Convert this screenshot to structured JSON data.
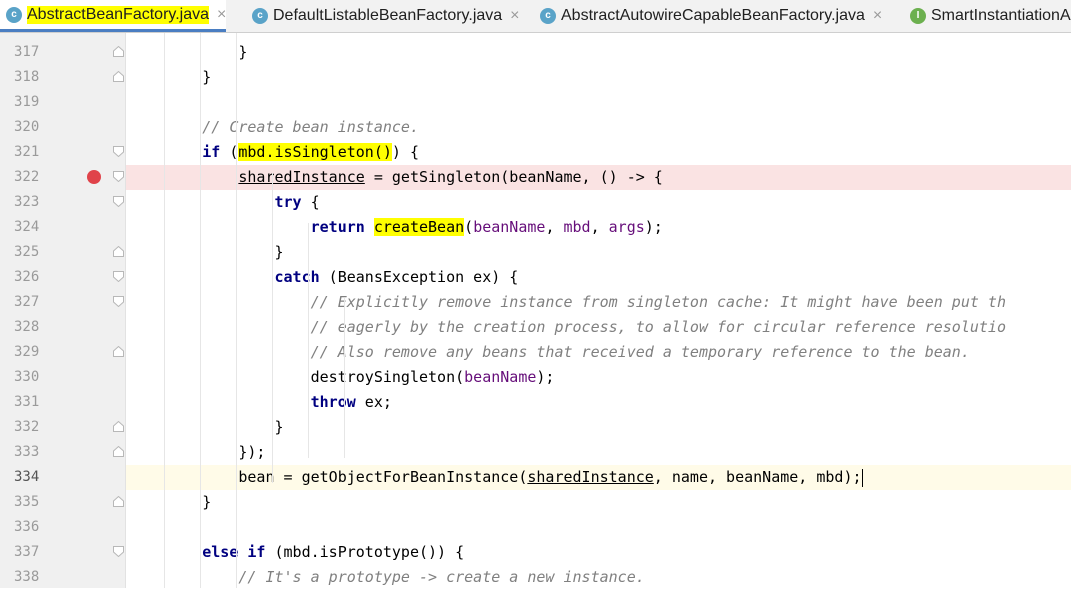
{
  "tabs": [
    {
      "label": "AbstractBeanFactory.java",
      "icon": "class-icon",
      "badge": "c",
      "active": true,
      "highlight": true
    },
    {
      "label": "DefaultListableBeanFactory.java",
      "icon": "class-icon",
      "badge": "c",
      "active": false
    },
    {
      "label": "AbstractAutowireCapableBeanFactory.java",
      "icon": "class-icon",
      "badge": "c",
      "active": false
    },
    {
      "label": "SmartInstantiationA",
      "icon": "interface-icon",
      "badge": "I",
      "active": false
    }
  ],
  "tab_close": "×",
  "colors": {
    "keyword": "#000080",
    "comment": "#808080",
    "field": "#660e7a",
    "breakpoint": "#e0434a",
    "search_highlight": "#ffff00",
    "active_tab_underline": "#4a7ec2"
  },
  "editor": {
    "breakpoint_line": "322",
    "caret_line": "334",
    "lines": [
      {
        "num": "317",
        "segments": [
          {
            "t": "            }"
          }
        ]
      },
      {
        "num": "318",
        "segments": [
          {
            "t": "        }"
          }
        ]
      },
      {
        "num": "319",
        "segments": [
          {
            "t": ""
          }
        ]
      },
      {
        "num": "320",
        "segments": [
          {
            "t": "        "
          },
          {
            "t": "// Create bean instance.",
            "c": "cm"
          }
        ]
      },
      {
        "num": "321",
        "segments": [
          {
            "t": "        "
          },
          {
            "t": "if",
            "c": "kw"
          },
          {
            "t": " ("
          },
          {
            "t": "mbd.isSingleton()",
            "c": "hl"
          },
          {
            "t": ") {"
          }
        ]
      },
      {
        "num": "322",
        "segments": [
          {
            "t": "            "
          },
          {
            "t": "sharedInstance",
            "c": "ul"
          },
          {
            "t": " = getSingleton(beanName, () -> {"
          }
        ]
      },
      {
        "num": "323",
        "segments": [
          {
            "t": "                "
          },
          {
            "t": "try",
            "c": "kw"
          },
          {
            "t": " {"
          }
        ]
      },
      {
        "num": "324",
        "segments": [
          {
            "t": "                    "
          },
          {
            "t": "return",
            "c": "kw"
          },
          {
            "t": " "
          },
          {
            "t": "createBean",
            "c": "hl"
          },
          {
            "t": "("
          },
          {
            "t": "beanName",
            "c": "fld"
          },
          {
            "t": ", "
          },
          {
            "t": "mbd",
            "c": "fld"
          },
          {
            "t": ", "
          },
          {
            "t": "args",
            "c": "fld"
          },
          {
            "t": ");"
          }
        ]
      },
      {
        "num": "325",
        "segments": [
          {
            "t": "                }"
          }
        ]
      },
      {
        "num": "326",
        "segments": [
          {
            "t": "                "
          },
          {
            "t": "catch",
            "c": "kw"
          },
          {
            "t": " (BeansException ex) {"
          }
        ]
      },
      {
        "num": "327",
        "segments": [
          {
            "t": "                    "
          },
          {
            "t": "// Explicitly remove instance from singleton cache: It might have been put th",
            "c": "cm"
          }
        ]
      },
      {
        "num": "328",
        "segments": [
          {
            "t": "                    "
          },
          {
            "t": "// eagerly by the creation process, to allow for circular reference resolutio",
            "c": "cm"
          }
        ]
      },
      {
        "num": "329",
        "segments": [
          {
            "t": "                    "
          },
          {
            "t": "// Also remove any beans that received a temporary reference to the bean.",
            "c": "cm"
          }
        ]
      },
      {
        "num": "330",
        "segments": [
          {
            "t": "                    destroySingleton("
          },
          {
            "t": "beanName",
            "c": "fld"
          },
          {
            "t": ");"
          }
        ]
      },
      {
        "num": "331",
        "segments": [
          {
            "t": "                    "
          },
          {
            "t": "throw",
            "c": "kw"
          },
          {
            "t": " ex;"
          }
        ]
      },
      {
        "num": "332",
        "segments": [
          {
            "t": "                }"
          }
        ]
      },
      {
        "num": "333",
        "segments": [
          {
            "t": "            });"
          }
        ]
      },
      {
        "num": "334",
        "segments": [
          {
            "t": "            bean = getObjectForBeanInstance("
          },
          {
            "t": "sharedInstance",
            "c": "ul"
          },
          {
            "t": ", name, beanName, mbd);"
          }
        ]
      },
      {
        "num": "335",
        "segments": [
          {
            "t": "        }"
          }
        ]
      },
      {
        "num": "336",
        "segments": [
          {
            "t": ""
          }
        ]
      },
      {
        "num": "337",
        "segments": [
          {
            "t": "        "
          },
          {
            "t": "else if",
            "c": "kw"
          },
          {
            "t": " (mbd.isPrototype()) {"
          }
        ]
      },
      {
        "num": "338",
        "segments": [
          {
            "t": "            "
          },
          {
            "t": "// It's a prototype -> create a new instance.",
            "c": "cm"
          }
        ]
      }
    ]
  }
}
